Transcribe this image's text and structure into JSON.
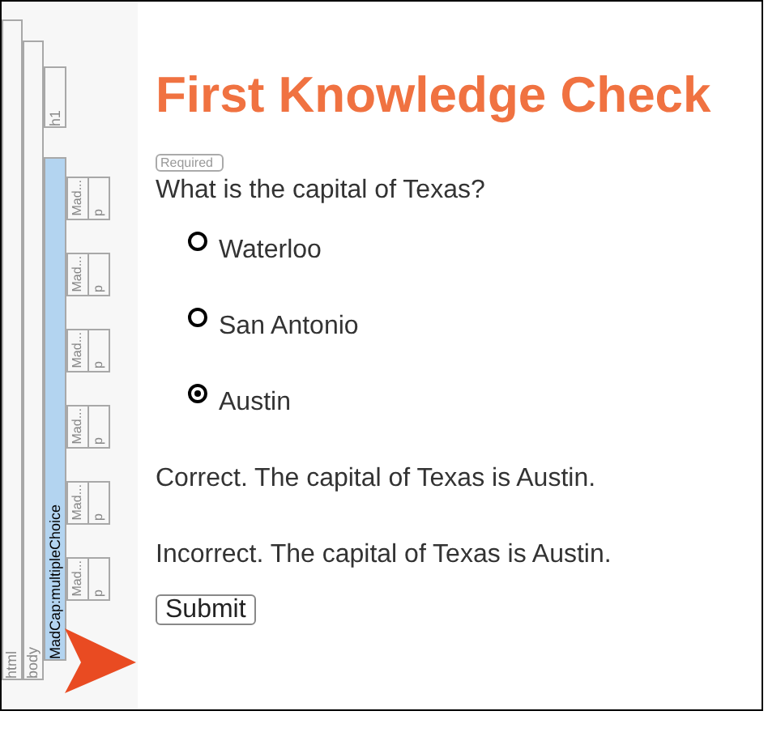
{
  "structure_bars": [
    {
      "label": "html",
      "selected": false
    },
    {
      "label": "body",
      "selected": false
    },
    {
      "label": "h1",
      "selected": false
    },
    {
      "label": "MadCap:multipleChoice",
      "selected": true
    }
  ],
  "element_rows": [
    {
      "tag": "Mad...",
      "child": "p"
    },
    {
      "tag": "Mad...",
      "child": "p"
    },
    {
      "tag": "Mad...",
      "child": "p"
    },
    {
      "tag": "Mad...",
      "child": "p"
    },
    {
      "tag": "Mad...",
      "child": "p"
    },
    {
      "tag": "Mad...",
      "child": "p"
    }
  ],
  "heading": "First Knowledge Check",
  "required_badge": "Required",
  "question": "What is the capital of Texas?",
  "options": [
    {
      "label": "Waterloo",
      "selected": false
    },
    {
      "label": "San Antonio",
      "selected": false
    },
    {
      "label": "Austin",
      "selected": true
    }
  ],
  "feedback": [
    {
      "text": "Correct. The capital of Texas is Austin."
    },
    {
      "text": "Incorrect. The capital of Texas is Austin."
    }
  ],
  "submit_button": "Submit"
}
